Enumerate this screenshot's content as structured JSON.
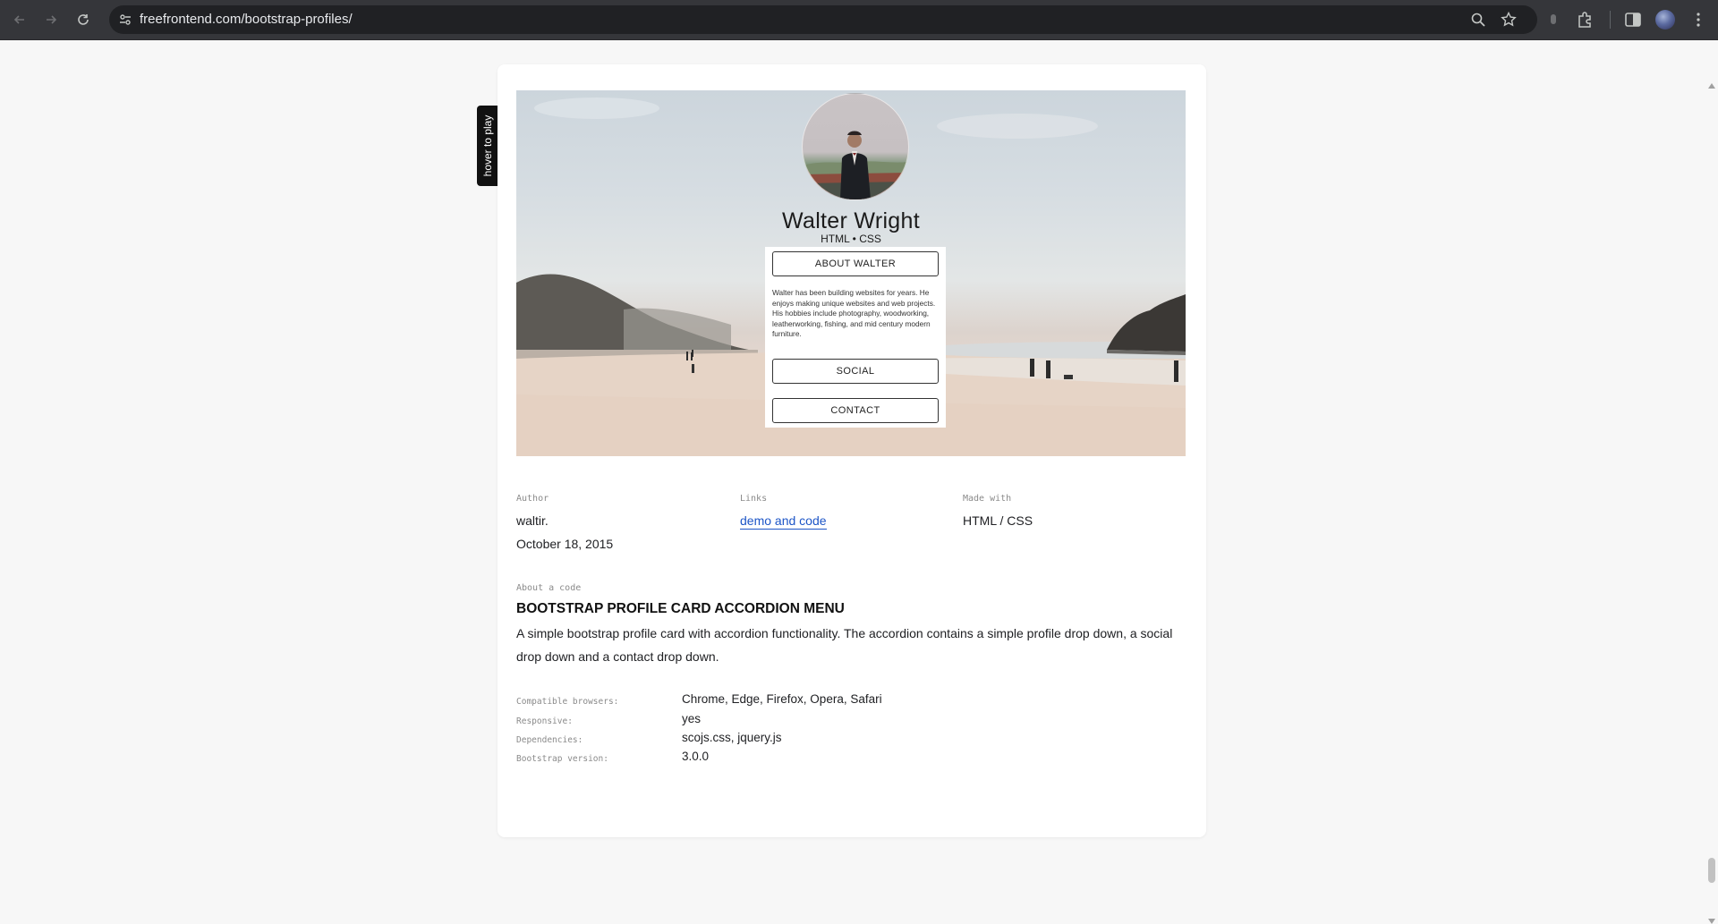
{
  "browser": {
    "url": "freefrontend.com/bootstrap-profiles/",
    "icons": [
      "back-icon",
      "forward-icon",
      "reload-icon",
      "site-info-icon",
      "zoom-icon",
      "bookmark-star-icon",
      "extension-puzzle-icon",
      "side-panel-icon",
      "profile-avatar",
      "menu-kebab-icon"
    ]
  },
  "preview": {
    "hover_tab": "hover to play",
    "name": "Walter Wright",
    "role": "HTML • CSS",
    "about_label": "ABOUT WALTER",
    "about_text": "Walter has been building websites for years. He enjoys making unique websites and web projects. His hobbies include photography, woodworking, leatherworking, fishing, and mid century modern furniture.",
    "social_label": "SOCIAL",
    "contact_label": "CONTACT"
  },
  "meta": {
    "author_label": "Author",
    "author": "waltir.",
    "date": "October 18, 2015",
    "links_label": "Links",
    "link_text": "demo and code",
    "made_with_label": "Made with",
    "made_with": "HTML / CSS"
  },
  "about_code": {
    "label": "About a code",
    "title": "BOOTSTRAP PROFILE CARD ACCORDION MENU",
    "description": "A simple bootstrap profile card with accordion functionality. The accordion contains a simple profile drop down, a social drop down and a contact drop down."
  },
  "specs": [
    {
      "label": "Compatible browsers:",
      "value": "Chrome, Edge, Firefox, Opera, Safari"
    },
    {
      "label": "Responsive:",
      "value": "yes"
    },
    {
      "label": "Dependencies:",
      "value": "scojs.css, jquery.js"
    },
    {
      "label": "Bootstrap version:",
      "value": "3.0.0"
    }
  ]
}
